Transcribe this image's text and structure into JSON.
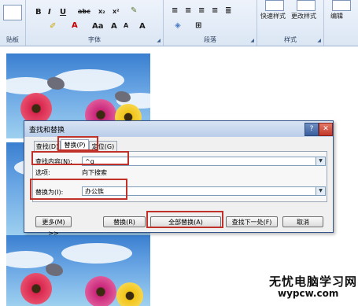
{
  "ribbon": {
    "groups": {
      "clipboard": "贴板",
      "font": "字体",
      "paragraph": "段落",
      "styles": "样式",
      "editing": "编辑"
    },
    "font_buttons": [
      "B",
      "I",
      "U",
      "abc",
      "x₂",
      "x²"
    ],
    "quick_styles": "快速样式",
    "change_styles": "更改样式"
  },
  "dialog": {
    "title": "查找和替换",
    "help": "?",
    "close": "✕",
    "tabs": [
      {
        "label": "查找(D)",
        "active": false
      },
      {
        "label": "替换(P)",
        "active": true
      },
      {
        "label": "定位(G)",
        "active": false
      }
    ],
    "find": {
      "label": "查找内容(N):",
      "value": "^g"
    },
    "options": {
      "label": "选项:",
      "value": "向下搜索"
    },
    "replace": {
      "label": "替换为(I):",
      "value": "办公族"
    },
    "buttons": {
      "more": "更多(M) >>",
      "replace": "替换(R)",
      "replace_all": "全部替换(A)",
      "find_next": "查找下一处(F)",
      "cancel": "取消"
    }
  },
  "watermark": {
    "text": "无忧电脑学习网",
    "url": "wypcw.com"
  },
  "colors": {
    "highlight_box": "#c0312a",
    "ribbon_bg": "#dbe6f4",
    "title_bar": "#b9cde9"
  }
}
